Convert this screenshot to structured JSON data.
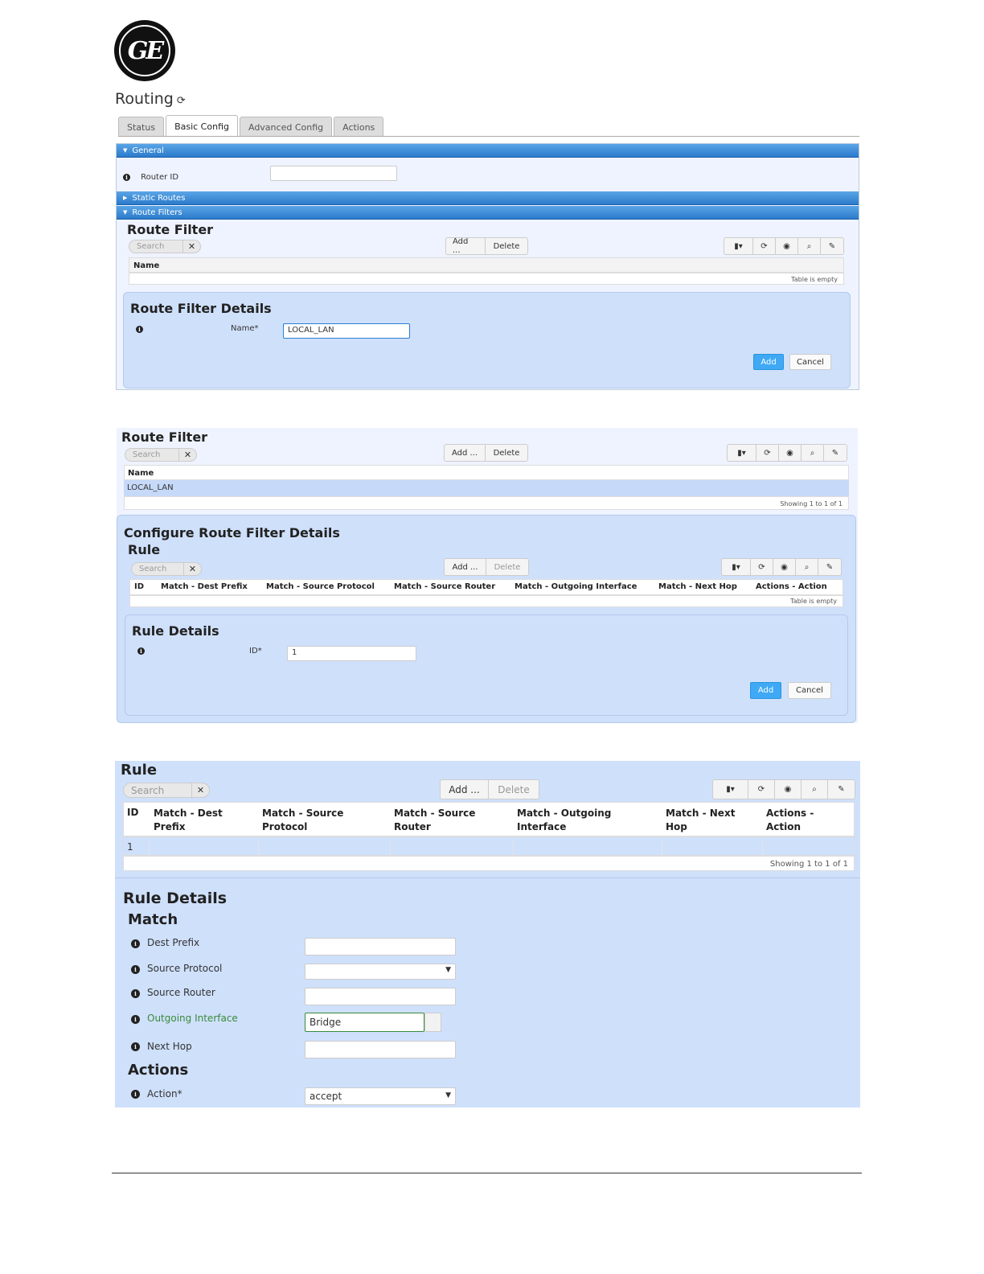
{
  "page": {
    "title": "Routing",
    "refresh_icon": "refresh-icon"
  },
  "tabs": [
    {
      "label": "Status",
      "active": false
    },
    {
      "label": "Basic Config",
      "active": true
    },
    {
      "label": "Advanced Config",
      "active": false
    },
    {
      "label": "Actions",
      "active": false
    }
  ],
  "general": {
    "label": "General",
    "router_id_label": "Router ID",
    "router_id_value": ""
  },
  "static_routes_label": "Static Routes",
  "route_filters_label": "Route Filters",
  "route_filter_1": {
    "title": "Route Filter",
    "search_placeholder": "Search",
    "add_label": "Add ...",
    "delete_label": "Delete",
    "col_name": "Name",
    "empty_text": "Table is empty"
  },
  "route_filter_details": {
    "title": "Route Filter Details",
    "name_label": "Name*",
    "name_value": "LOCAL_LAN",
    "add_label": "Add",
    "cancel_label": "Cancel"
  },
  "route_filter_2": {
    "title": "Route Filter",
    "search_placeholder": "Search",
    "add_label": "Add ...",
    "delete_label": "Delete",
    "col_name": "Name",
    "rows": [
      "LOCAL_LAN"
    ],
    "showing": "Showing 1 to 1 of 1"
  },
  "configure": {
    "title": "Configure Route Filter Details",
    "rule_title": "Rule",
    "search_placeholder": "Search",
    "add_label": "Add ...",
    "delete_label": "Delete",
    "columns": [
      "ID",
      "Match - Dest Prefix",
      "Match - Source Protocol",
      "Match - Source Router",
      "Match - Outgoing Interface",
      "Match - Next Hop",
      "Actions - Action"
    ],
    "empty_text": "Table is empty",
    "details_title": "Rule Details",
    "id_label": "ID*",
    "id_value": "1",
    "add_label2": "Add",
    "cancel_label": "Cancel"
  },
  "rule": {
    "title": "Rule",
    "search_placeholder": "Search",
    "add_label": "Add ...",
    "delete_label": "Delete",
    "columns": [
      "ID",
      "Match - Dest Prefix",
      "Match - Source Protocol",
      "Match - Source Router",
      "Match - Outgoing Interface",
      "Match - Next Hop",
      "Actions - Action"
    ],
    "rows": [
      [
        "1",
        "",
        "",
        "",
        "",
        "",
        ""
      ]
    ],
    "showing": "Showing 1 to 1 of 1"
  },
  "rule_details": {
    "title": "Rule Details",
    "match_title": "Match",
    "dest_prefix_label": "Dest Prefix",
    "source_protocol_label": "Source Protocol",
    "source_router_label": "Source Router",
    "outgoing_interface_label": "Outgoing Interface",
    "outgoing_interface_value": "Bridge",
    "next_hop_label": "Next Hop",
    "actions_title": "Actions",
    "action_label": "Action*",
    "action_value": "accept"
  },
  "colors": {
    "accent_bar": "#2c7bcc",
    "panel_bg": "#cfe0fb",
    "add_button": "#3fa9f5",
    "outgoing_label": "#3a8a3a"
  }
}
